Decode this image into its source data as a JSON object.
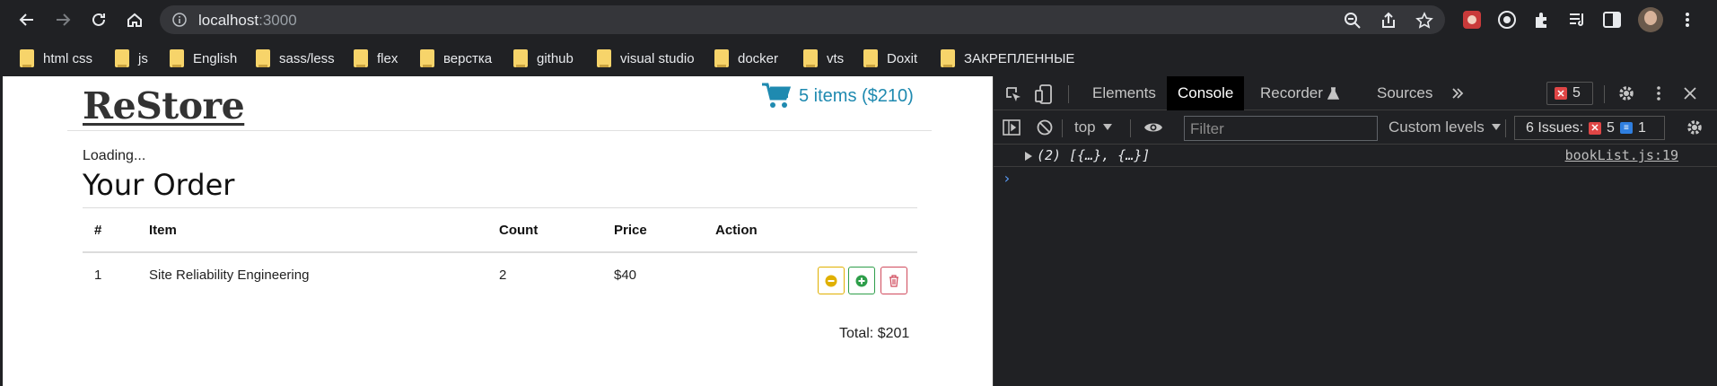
{
  "browser": {
    "url_host": "localhost",
    "url_port": ":3000",
    "bookmarks": [
      "html css",
      "js",
      "English",
      "sass/less",
      "flex",
      "верстка",
      "github",
      "visual studio",
      "docker",
      "vts",
      "Doxit",
      "ЗАКРЕПЛЕННЫЕ"
    ]
  },
  "app": {
    "brand": "ReStore",
    "cart_summary": "5 items ($210)",
    "loading_text": "Loading...",
    "order_title": "Your Order",
    "table": {
      "headers": [
        "#",
        "Item",
        "Count",
        "Price",
        "Action"
      ],
      "rows": [
        {
          "index": "1",
          "item": "Site Reliability Engineering",
          "count": "2",
          "price": "$40"
        }
      ]
    },
    "total": "Total: $201"
  },
  "devtools": {
    "tabs": [
      "Elements",
      "Console",
      "Recorder",
      "Sources"
    ],
    "active_tab": "Console",
    "error_count": "5",
    "context": "top",
    "filter_placeholder": "Filter",
    "levels": "Custom levels",
    "issues_label": "6 Issues:",
    "issues_errors": "5",
    "issues_info": "1",
    "log_expression": "(2) [{…}, {…}]",
    "log_source": "bookList.js:19",
    "prompt_symbol": "›"
  },
  "colors": {
    "accent_blue": "#1f8ab0",
    "warning_btn": "#e0b000",
    "success_btn": "#2e9e4a",
    "danger_btn": "#d04a5c",
    "devtools_bg": "#202124"
  }
}
